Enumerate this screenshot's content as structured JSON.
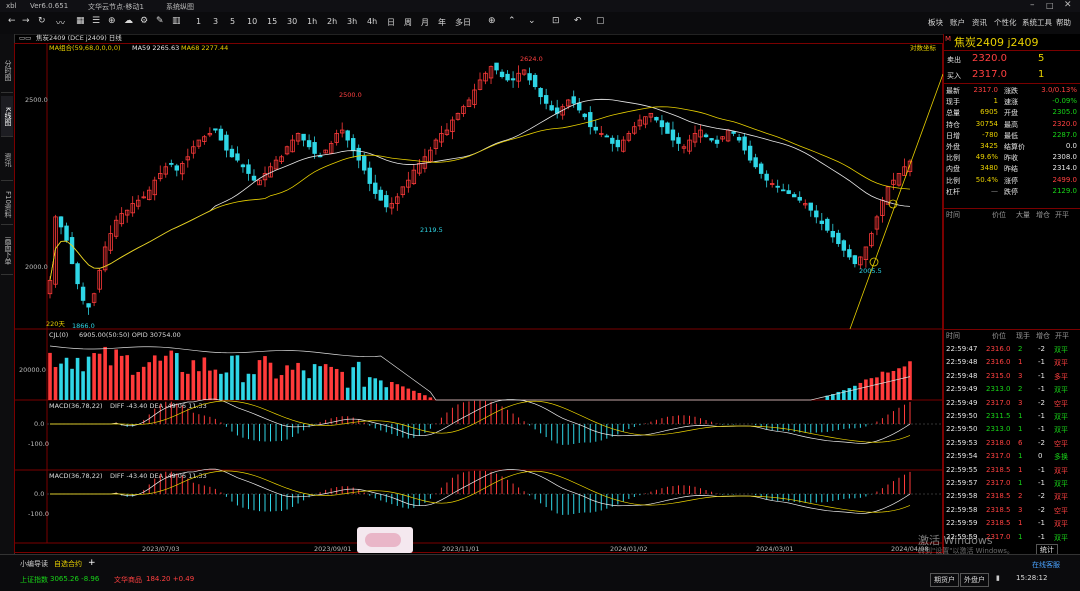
{
  "titlebar": {
    "app": "xbl",
    "version": "Ver6.0.651",
    "server": "文华云节点-移动1",
    "layout": "系统纵图"
  },
  "toolbar": {
    "periods": [
      "1",
      "3",
      "5",
      "10",
      "15",
      "30",
      "1h",
      "2h",
      "3h",
      "4h",
      "日",
      "周",
      "月",
      "年",
      "多日"
    ],
    "right_items": [
      "板块",
      "账户",
      "资讯",
      "个性化",
      "系统工具",
      "帮助"
    ]
  },
  "left_tabs": [
    "分时图",
    "K线图",
    "资讯",
    "F10资料",
    "画面下单"
  ],
  "main_chart": {
    "header": "焦炭2409  (DCE j2409)   日线",
    "ma_line": "MA组合(59,68,0,0,0,0)",
    "ma59": "MA59 2265.63",
    "ma68": "MA68 2277.44",
    "ma59_color": "#e8e8e8",
    "ma68_color": "#e8d000",
    "coord_toggle": "对数坐标",
    "y_labels": [
      "2500.0",
      "2000.0"
    ],
    "annotations": {
      "high": "2624.0",
      "mid_high": "2500.0",
      "low1": "2119.5",
      "low2": "2005.5",
      "low3": "1866.0",
      "days": "220天"
    },
    "dates": [
      "2023/07/03",
      "2023/09/01",
      "2023/11/01",
      "2024/01/02",
      "2024/03/01",
      "2024/04/08"
    ]
  },
  "volume_panel": {
    "header": "CJL(0)",
    "values": "6905.00(50:50)   OPID 30754.00",
    "y_label": "20000.0"
  },
  "macd1": {
    "header": "MACD(36,78,22)",
    "values": "DIFF -43.40   DEA -49.06   11.33",
    "y_labels": [
      "0.0",
      "-100.0"
    ]
  },
  "macd2": {
    "header": "MACD(36,78,22)",
    "values": "DIFF -43.40   DEA -49.06   11.33",
    "y_labels": [
      "0.0",
      "-100.0"
    ]
  },
  "quote": {
    "title": "焦炭2409  j2409",
    "sell_label": "卖出",
    "sell_price": "2320.0",
    "sell_qty": "5",
    "buy_label": "买入",
    "buy_price": "2317.0",
    "buy_qty": "1",
    "rows": [
      {
        "l1": "最新",
        "v1": "2317.0",
        "c1": "red",
        "l2": "涨跌",
        "v2": "3.0/0.13%",
        "c2": "red"
      },
      {
        "l1": "现手",
        "v1": "1",
        "c1": "yellow",
        "l2": "速涨",
        "v2": "-0.09%",
        "c2": "green"
      },
      {
        "l1": "总量",
        "v1": "6905",
        "c1": "yellow",
        "l2": "开盘",
        "v2": "2305.0",
        "c2": "green"
      },
      {
        "l1": "持仓",
        "v1": "30754",
        "c1": "yellow",
        "l2": "最高",
        "v2": "2320.0",
        "c2": "red"
      },
      {
        "l1": "日增",
        "v1": "-780",
        "c1": "yellow",
        "l2": "最低",
        "v2": "2287.0",
        "c2": "green"
      },
      {
        "l1": "外盘",
        "v1": "3425",
        "c1": "yellow",
        "l2": "结算价",
        "v2": "0.0",
        "c2": "white"
      },
      {
        "l1": "比例",
        "v1": "49.6%",
        "c1": "yellow",
        "l2": "昨收",
        "v2": "2308.0",
        "c2": "white"
      },
      {
        "l1": "内盘",
        "v1": "3480",
        "c1": "yellow",
        "l2": "昨结",
        "v2": "2314.0",
        "c2": "white"
      },
      {
        "l1": "比例",
        "v1": "50.4%",
        "c1": "yellow",
        "l2": "涨停",
        "v2": "2499.0",
        "c2": "red"
      },
      {
        "l1": "杠杆",
        "v1": "—",
        "c1": "gray",
        "l2": "跌停",
        "v2": "2129.0",
        "c2": "green"
      }
    ],
    "tick_header": [
      "时间",
      "价位",
      "大量",
      "增仓",
      "开平"
    ],
    "tick_header2": [
      "时间",
      "价位",
      "现手",
      "增仓",
      "开平"
    ],
    "ticks": [
      {
        "time": "22:59:47",
        "price": "2316.0",
        "pc": "red",
        "qty": "2",
        "chg": "-2",
        "type": "双平",
        "tc": "green"
      },
      {
        "time": "22:59:48",
        "price": "2316.0",
        "pc": "red",
        "qty": "1",
        "chg": "-1",
        "type": "双平",
        "tc": "red"
      },
      {
        "time": "22:59:48",
        "price": "2315.0",
        "pc": "red",
        "qty": "3",
        "chg": "-1",
        "type": "多平",
        "tc": "red"
      },
      {
        "time": "22:59:49",
        "price": "2313.0",
        "pc": "green",
        "qty": "2",
        "chg": "-1",
        "type": "双平",
        "tc": "green"
      },
      {
        "time": "22:59:49",
        "price": "2317.0",
        "pc": "red",
        "qty": "3",
        "chg": "-2",
        "type": "空平",
        "tc": "red"
      },
      {
        "time": "22:59:50",
        "price": "2311.5",
        "pc": "green",
        "qty": "1",
        "chg": "-1",
        "type": "双平",
        "tc": "green"
      },
      {
        "time": "22:59:50",
        "price": "2313.0",
        "pc": "green",
        "qty": "1",
        "chg": "-1",
        "type": "双平",
        "tc": "green"
      },
      {
        "time": "22:59:53",
        "price": "2318.0",
        "pc": "red",
        "qty": "6",
        "chg": "-2",
        "type": "空平",
        "tc": "red"
      },
      {
        "time": "22:59:54",
        "price": "2317.0",
        "pc": "red",
        "qty": "1",
        "chg": "0",
        "type": "多换",
        "tc": "green"
      },
      {
        "time": "22:59:55",
        "price": "2318.5",
        "pc": "red",
        "qty": "1",
        "chg": "-1",
        "type": "双平",
        "tc": "red"
      },
      {
        "time": "22:59:57",
        "price": "2317.0",
        "pc": "red",
        "qty": "1",
        "chg": "-1",
        "type": "双平",
        "tc": "green"
      },
      {
        "time": "22:59:58",
        "price": "2318.5",
        "pc": "red",
        "qty": "2",
        "chg": "-2",
        "type": "双平",
        "tc": "red"
      },
      {
        "time": "22:59:58",
        "price": "2318.5",
        "pc": "red",
        "qty": "3",
        "chg": "-2",
        "type": "空平",
        "tc": "red"
      },
      {
        "time": "22:59:59",
        "price": "2318.5",
        "pc": "red",
        "qty": "1",
        "chg": "-1",
        "type": "双平",
        "tc": "red"
      },
      {
        "time": "22:59:59",
        "price": "2317.0",
        "pc": "red",
        "qty": "1",
        "chg": "-1",
        "type": "双平",
        "tc": "green"
      }
    ],
    "stats_label": "统计"
  },
  "statusbar": {
    "tabs": [
      "小编导读",
      "自选合约"
    ],
    "add": "+",
    "sh_label": "上证指数",
    "sh_value": "3065.26  -8.96",
    "wh_label": "文华商品",
    "wh_value": "184.20  +0.49",
    "buttons": [
      "期货户",
      "外盘户"
    ],
    "time": "15:28:12",
    "cloud": "在线客服",
    "watermark_line1": "激活 Windows",
    "watermark_line2": "转到\"设置\"以激活 Windows。"
  },
  "chart_data": {
    "type": "candlestick",
    "title": "焦炭2409 (DCE j2409) 日线",
    "x_labels": [
      "2023/07/03",
      "2023/09/01",
      "2023/11/01",
      "2024/01/02",
      "2024/03/01",
      "2024/04/08"
    ],
    "ylim": [
      1840,
      2660
    ],
    "notable_points": {
      "high": 2624.0,
      "low_2023_06": 1866.0,
      "low_2023_10": 2119.5,
      "low_2024_03": 2005.5,
      "last": 2317.0
    },
    "ma59_last": 2265.63,
    "ma68_last": 2277.44,
    "close_path": [
      1960,
      2150,
      2120,
      2080,
      2010,
      1950,
      1900,
      1880,
      1920,
      1990,
      2060,
      2100,
      2140,
      2160,
      2170,
      2190,
      2200,
      2210,
      2230,
      2260,
      2280,
      2300,
      2310,
      2290,
      2310,
      2330,
      2360,
      2380,
      2390,
      2400,
      2410,
      2380,
      2350,
      2330,
      2320,
      2300,
      2280,
      2260,
      2260,
      2280,
      2300,
      2320,
      2330,
      2360,
      2380,
      2400,
      2380,
      2360,
      2340,
      2330,
      2350,
      2370,
      2400,
      2410,
      2380,
      2350,
      2320,
      2290,
      2250,
      2220,
      2200,
      2180,
      2190,
      2210,
      2240,
      2260,
      2290,
      2310,
      2330,
      2350,
      2380,
      2400,
      2410,
      2440,
      2460,
      2480,
      2500,
      2530,
      2560,
      2580,
      2600,
      2590,
      2570,
      2560,
      2560,
      2580,
      2590,
      2560,
      2540,
      2510,
      2490,
      2470,
      2460,
      2480,
      2500,
      2490,
      2470,
      2450,
      2420,
      2410,
      2400,
      2390,
      2370,
      2360,
      2380,
      2400,
      2420,
      2440,
      2450,
      2460,
      2440,
      2420,
      2400,
      2380,
      2370,
      2360,
      2380,
      2400,
      2410,
      2390,
      2380,
      2370,
      2390,
      2410,
      2400,
      2380,
      2350,
      2320,
      2300,
      2280,
      2260,
      2250,
      2240,
      2230,
      2220,
      2210,
      2200,
      2190,
      2170,
      2150,
      2130,
      2110,
      2090,
      2070,
      2050,
      2030,
      2010,
      2030,
      2060,
      2100,
      2150,
      2200,
      2240,
      2260,
      2280,
      2300,
      2317
    ]
  }
}
